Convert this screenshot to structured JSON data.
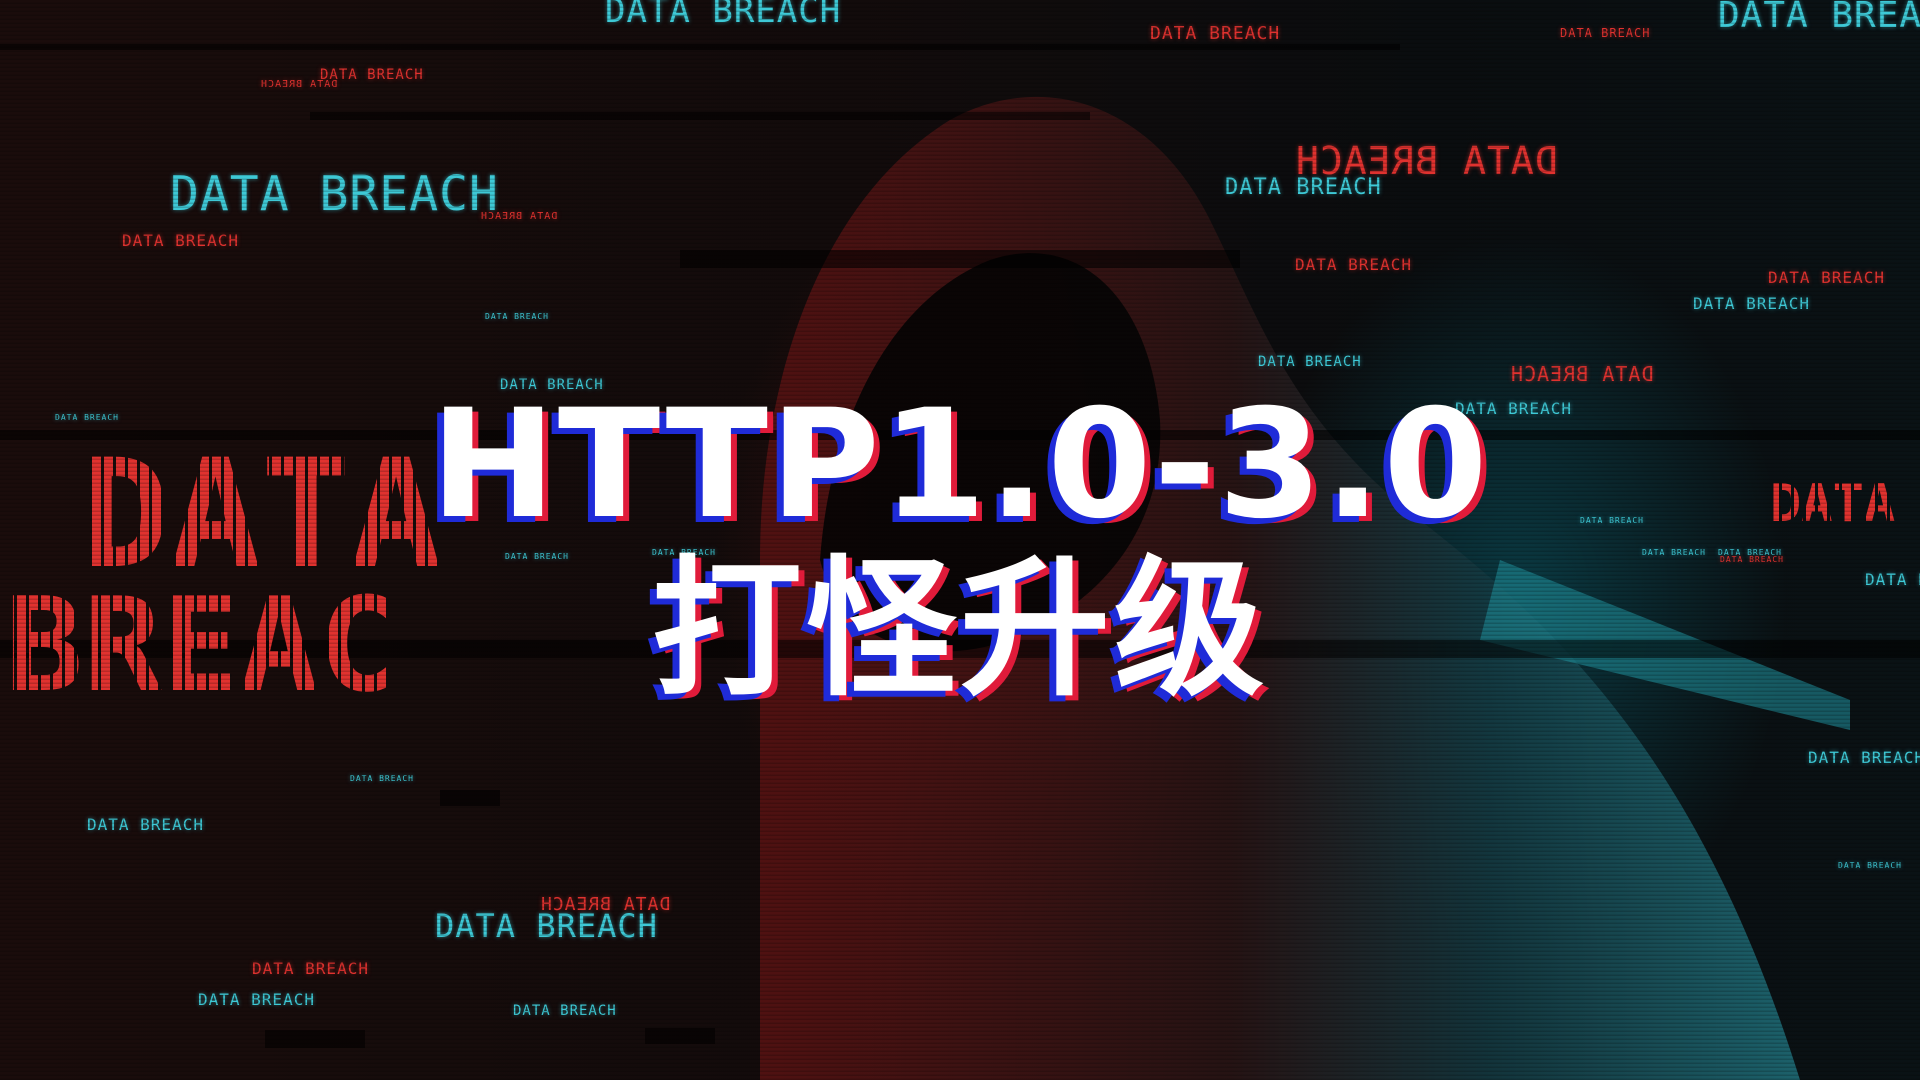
{
  "title": {
    "main": "HTTP1.0-3.0",
    "sub": "打怪升级"
  },
  "background": {
    "big_word": "DATA",
    "big_word_partial": "BREAC",
    "phrase": "DATA BREACH"
  },
  "colors": {
    "red": "#e0322f",
    "cyan": "#3ec9d6",
    "title_shadow_blue": "#1f2bd8",
    "title_shadow_red": "#e01b3a"
  }
}
